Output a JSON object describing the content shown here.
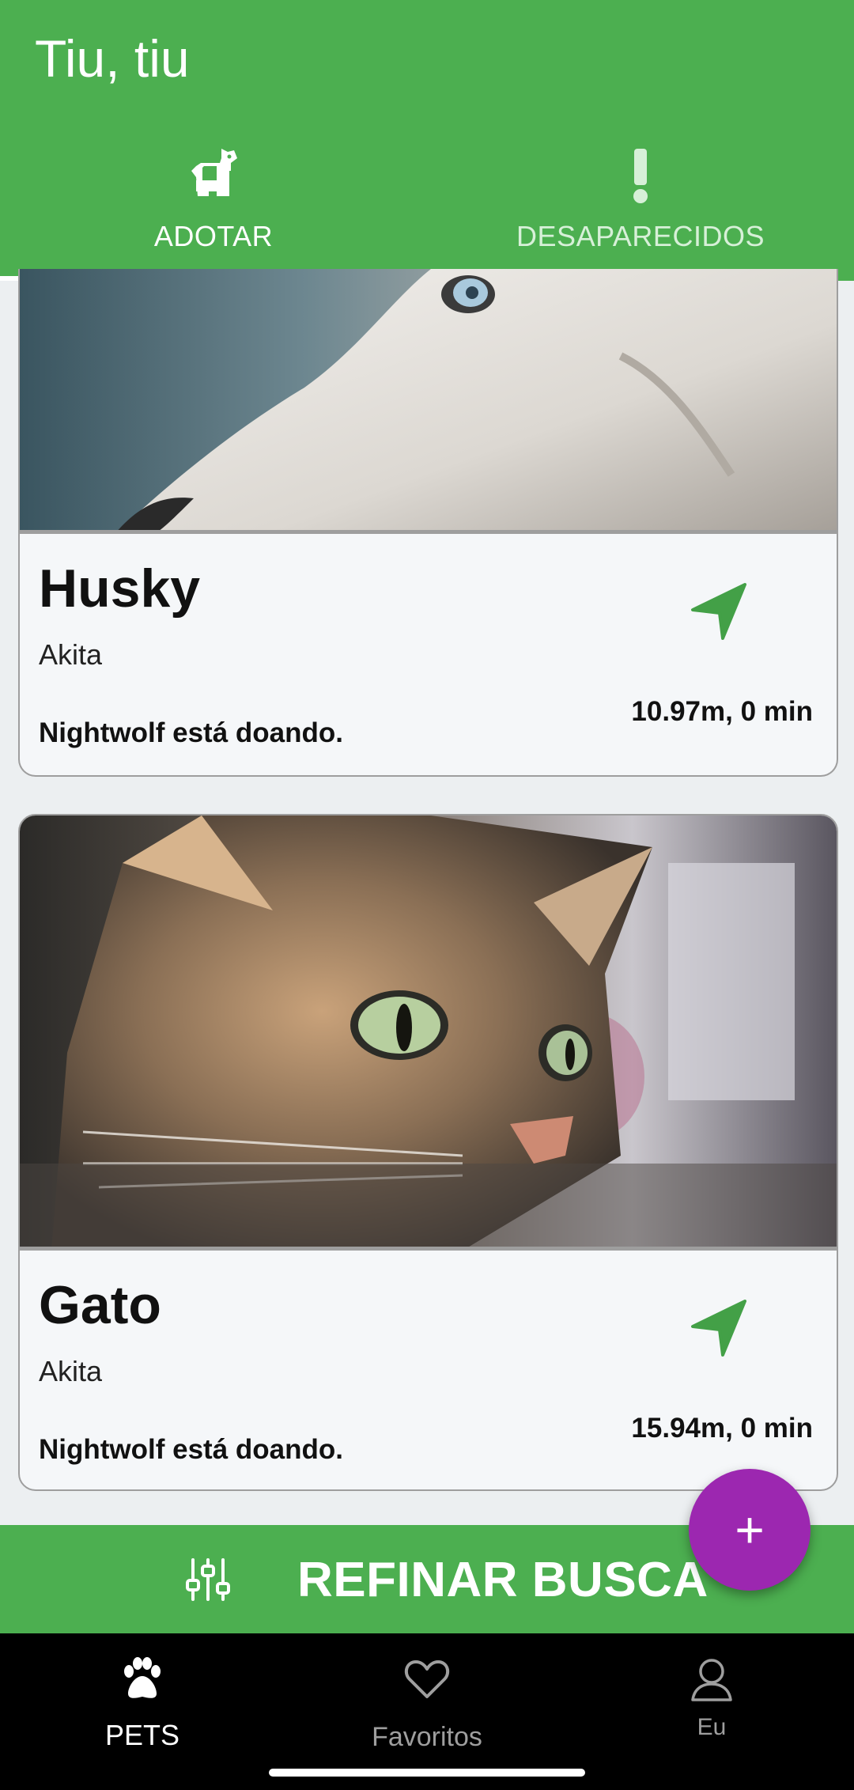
{
  "app": {
    "title": "Tiu, tiu"
  },
  "tabs": [
    {
      "label": "ADOTAR",
      "icon": "dog-icon",
      "active": true
    },
    {
      "label": "DESAPARECIDOS",
      "icon": "exclamation-icon",
      "active": false
    }
  ],
  "pets": [
    {
      "name": "Husky",
      "breed": "Akita",
      "donor": "Nightwolf está doando.",
      "distance": "10.97m, 0 min",
      "photo": "husky-photo"
    },
    {
      "name": "Gato",
      "breed": "Akita",
      "donor": "Nightwolf está doando.",
      "distance": "15.94m, 0 min",
      "photo": "cat-photo"
    }
  ],
  "refine": {
    "label": "REFINAR BUSCA",
    "icon": "sliders-icon"
  },
  "fab": {
    "label": "+",
    "icon": "plus-icon"
  },
  "bottom_nav": [
    {
      "label": "PETS",
      "icon": "paw-icon",
      "active": true
    },
    {
      "label": "Favoritos",
      "icon": "heart-icon",
      "active": false
    },
    {
      "label": "Eu",
      "icon": "person-icon",
      "active": false
    }
  ],
  "colors": {
    "primary": "#4caf50",
    "accent": "#9c27b0",
    "nav_arrow": "#43a047"
  }
}
